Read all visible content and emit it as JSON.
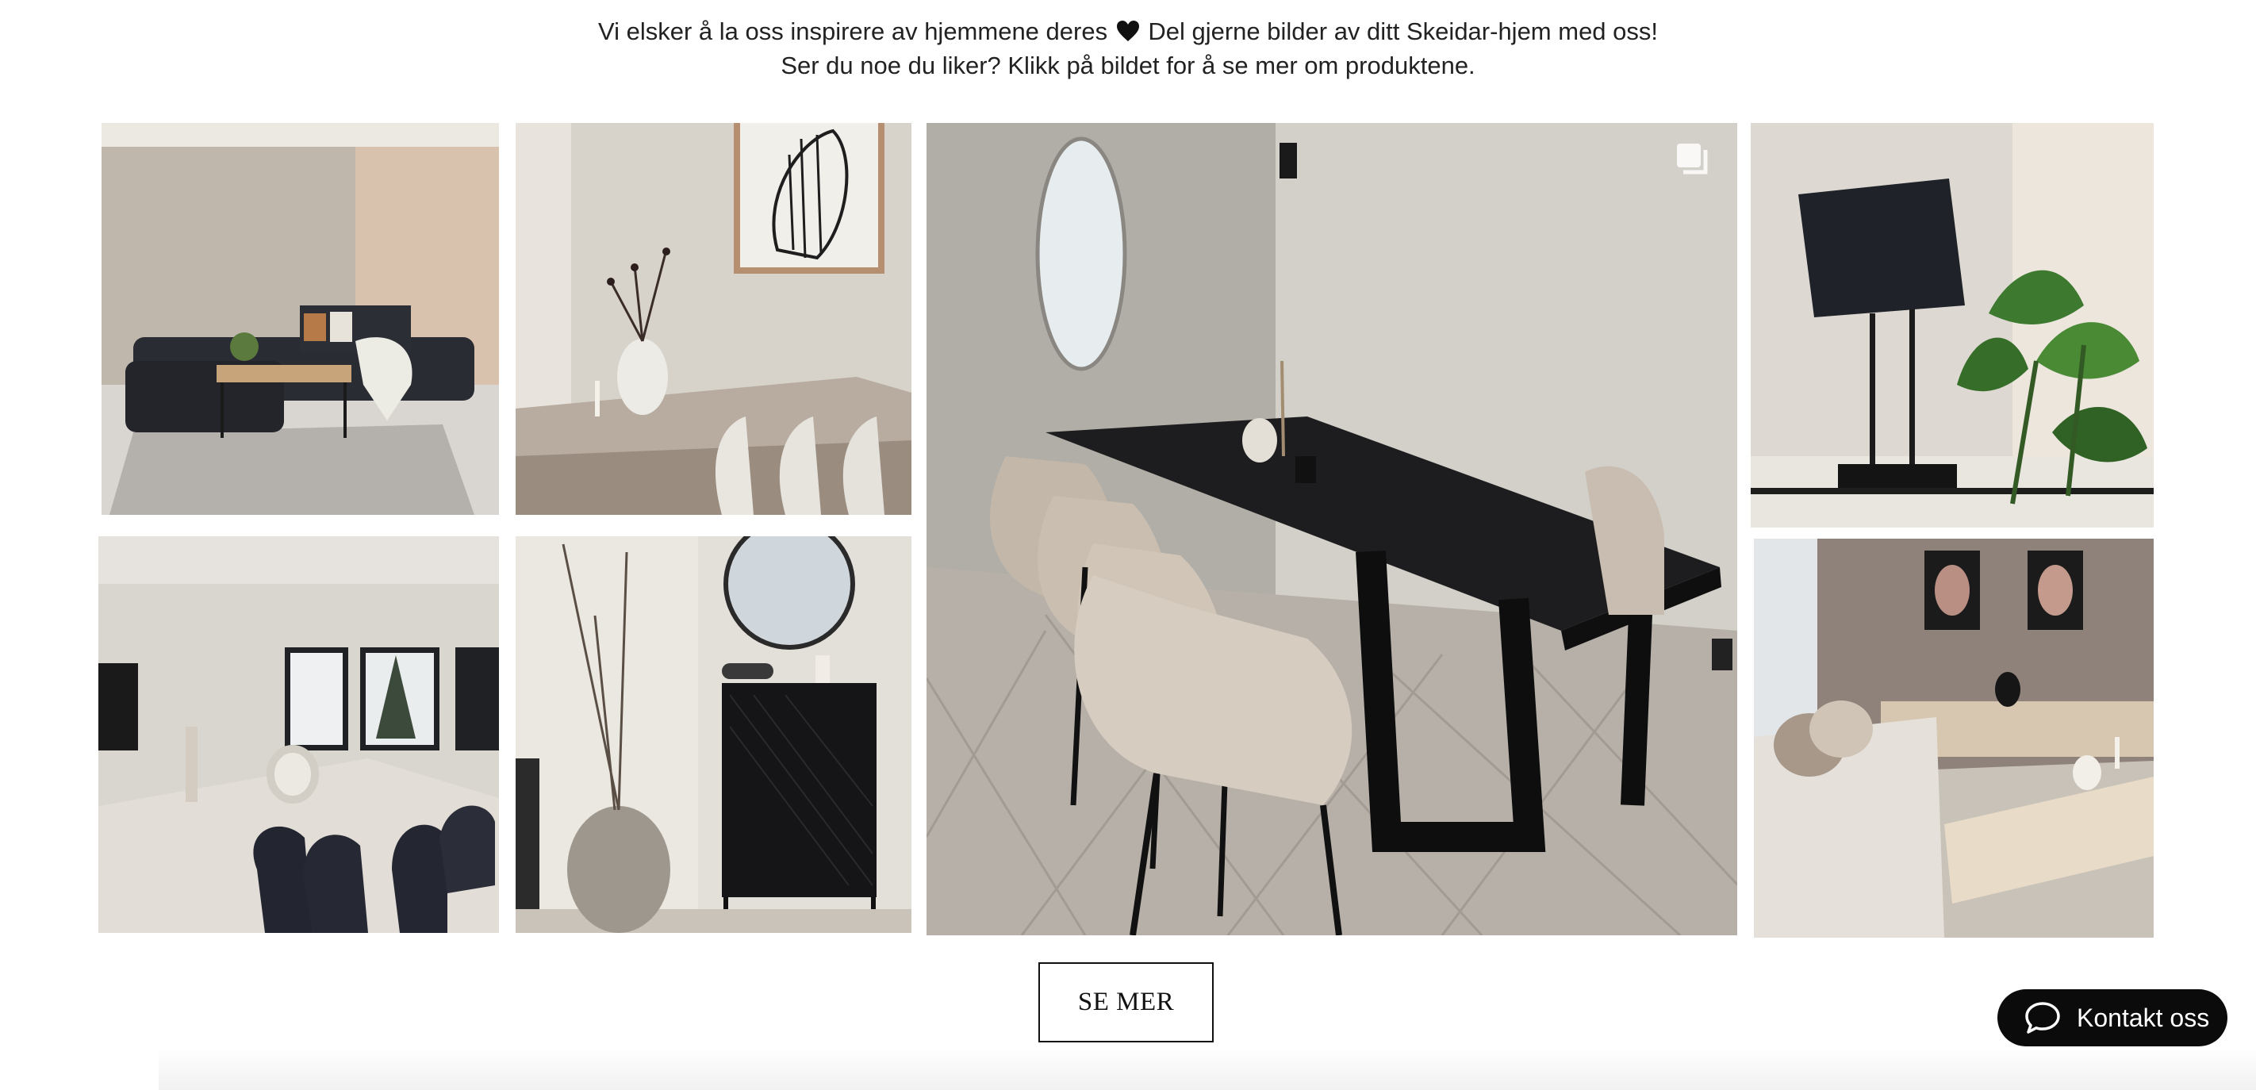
{
  "intro": {
    "line1_before": "Vi elsker å la oss inspirere av hjemmene deres",
    "line1_after": "Del gjerne bilder av ditt Skeidar-hjem med oss!",
    "line2": "Ser du noe du liker? Klikk på bildet for å se mer om produktene.",
    "heart_icon": "heart-icon"
  },
  "gallery": {
    "tiles": [
      {
        "name": "living-room-sofa-photo"
      },
      {
        "name": "dining-vase-art-photo"
      },
      {
        "name": "black-dining-table-photo",
        "badge_icon": "multiple-images-icon"
      },
      {
        "name": "table-lamp-plant-photo"
      },
      {
        "name": "open-dining-area-photo"
      },
      {
        "name": "black-cabinet-mirror-photo"
      },
      {
        "name": "lounge-sideboard-photo"
      }
    ]
  },
  "see_more": {
    "label": "SE MER"
  },
  "contact": {
    "label": "Kontakt oss",
    "icon": "chat-bubble-icon"
  },
  "colors": {
    "button_border": "#111111",
    "contact_bg": "#0b0b0b",
    "contact_text": "#ffffff"
  }
}
